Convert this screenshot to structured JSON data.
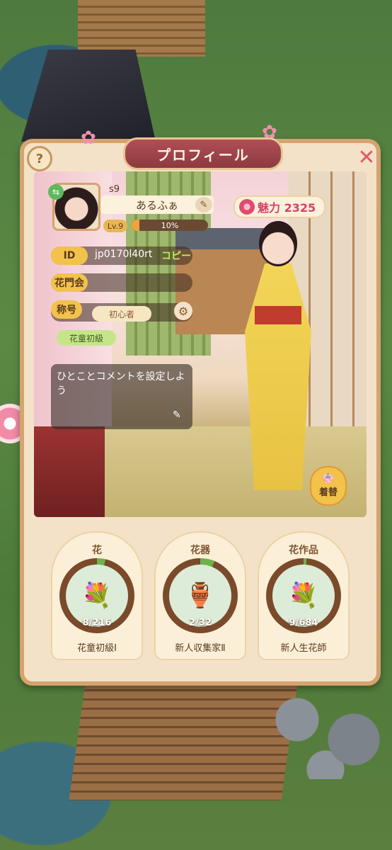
{
  "header": {
    "title": "プロフィール",
    "help_glyph": "?",
    "close_glyph": "✕"
  },
  "profile": {
    "server": "s9",
    "name": "あるふぁ",
    "level": "Lv.9",
    "exp_progress": 0.1,
    "exp_label": "10%",
    "charm_label": "魅力 2325",
    "id_label": "ID",
    "id_value": "jp0170l40rt",
    "copy_label": "コピー",
    "guild_label": "花門会",
    "title_label": "称号",
    "title_value": "初心者",
    "grade_value": "花童初級",
    "comment": "ひとことコメントを設定しよう",
    "dress_label": "着替"
  },
  "collections": [
    {
      "title": "花",
      "count": "8/216",
      "rank": "花童初級Ⅰ",
      "progress": 0.037,
      "icon": "flower-bouquet-icon",
      "glyph": "💐"
    },
    {
      "title": "花器",
      "count": "2/32",
      "rank": "新人収集家Ⅱ",
      "progress": 0.0625,
      "icon": "vase-icon",
      "glyph": "🏺"
    },
    {
      "title": "花作品",
      "count": "9/684",
      "rank": "新人生花師",
      "progress": 0.013,
      "icon": "arrangement-icon",
      "glyph": "💐"
    }
  ],
  "colors": {
    "panel_border": "#d5a36f",
    "title_plate": "#a8474d",
    "accent_yellow": "#f3c24b",
    "charm_pink": "#d94068",
    "copy_green": "#b7f05e",
    "progress_green": "#6eb24a"
  }
}
